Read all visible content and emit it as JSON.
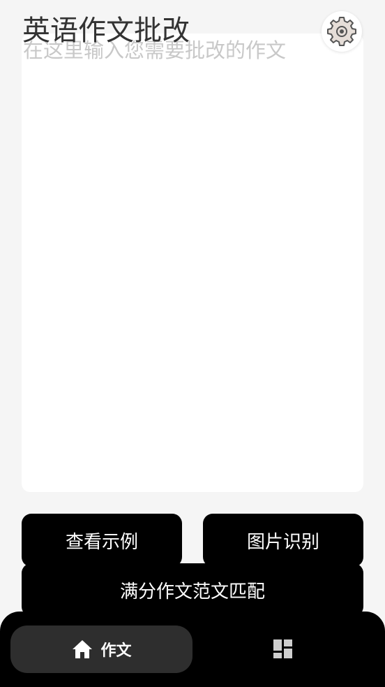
{
  "header": {
    "title": "英语作文批改",
    "settings_icon": "gear-icon"
  },
  "editor": {
    "placeholder": "在这里输入您需要批改的作文",
    "value": ""
  },
  "actions": {
    "view_example": "查看示例",
    "image_recognition": "图片识别",
    "full_score_match": "满分作文范文匹配"
  },
  "bottom_nav": {
    "home_label": "作文",
    "home_icon": "home-icon",
    "dashboard_icon": "dashboard-icon"
  },
  "colors": {
    "background": "#f5f5f5",
    "button_bg": "#000000",
    "active_tab_bg": "#2e2e2e",
    "placeholder_text": "#c8c8c8"
  }
}
